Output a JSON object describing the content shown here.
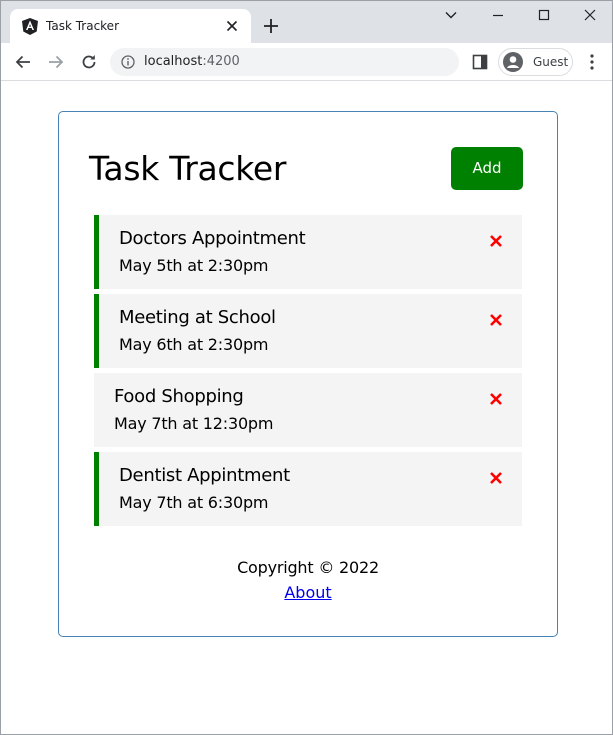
{
  "browser": {
    "tab_title": "Task Tracker",
    "url_host": "localhost",
    "url_port": ":4200",
    "profile_label": "Guest"
  },
  "app": {
    "title": "Task Tracker",
    "add_label": "Add",
    "add_color": "#008000",
    "reminder_color": "#008000",
    "delete_color": "#ff0000",
    "tasks": [
      {
        "text": "Doctors Appointment",
        "day": "May 5th at 2:30pm",
        "reminder": true
      },
      {
        "text": "Meeting at School",
        "day": "May 6th at 2:30pm",
        "reminder": true
      },
      {
        "text": "Food Shopping",
        "day": "May 7th at 12:30pm",
        "reminder": false
      },
      {
        "text": "Dentist Appintment",
        "day": "May 7th at 6:30pm",
        "reminder": true
      }
    ],
    "footer": {
      "copyright": "Copyright © 2022",
      "about_label": "About"
    }
  }
}
